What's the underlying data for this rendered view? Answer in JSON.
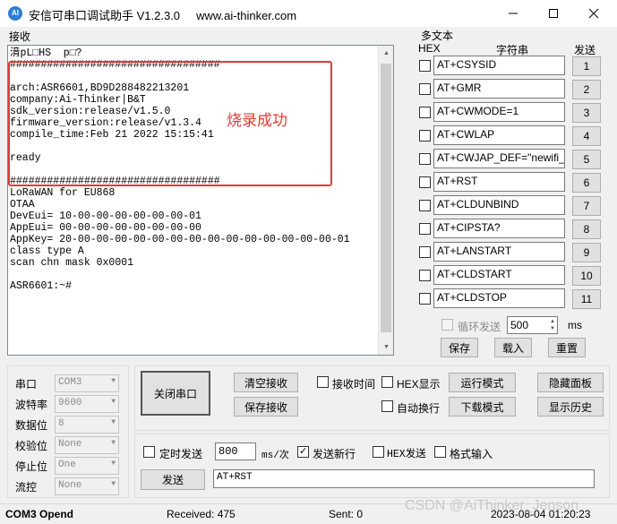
{
  "window": {
    "title": "安信可串口调试助手 V1.2.3.0",
    "url": "www.ai-thinker.com",
    "icon_text": "AI"
  },
  "receive": {
    "label": "接收",
    "text": "湇pL□HS  p□?\n##################################\n\narch:ASR6601,BD9D288482213201\ncompany:Ai-Thinker|B&T\nsdk_version:release/v1.5.0\nfirmware_version:release/v1.3.4\ncompile_time:Feb 21 2022 15:15:41\n\nready\n\n##################################\nLoRaWAN for EU868\nOTAA\nDevEui= 10-00-00-00-00-00-00-01\nAppEui= 00-00-00-00-00-00-00-00\nAppKey= 20-00-00-00-00-00-00-00-00-00-00-00-00-00-00-01\nclass type A\nscan chn mask 0x0001\n\nASR6601:~#",
    "annotation": "烧录成功"
  },
  "multi": {
    "title": "多文本",
    "header_hex": "HEX",
    "header_str": "字符串",
    "header_send": "发送",
    "rows": [
      {
        "cmd": "AT+CSYSID",
        "num": "1"
      },
      {
        "cmd": "AT+GMR",
        "num": "2"
      },
      {
        "cmd": "AT+CWMODE=1",
        "num": "3"
      },
      {
        "cmd": "AT+CWLAP",
        "num": "4"
      },
      {
        "cmd": "AT+CWJAP_DEF=\"newifi_",
        "num": "5"
      },
      {
        "cmd": "AT+RST",
        "num": "6"
      },
      {
        "cmd": "AT+CLDUNBIND",
        "num": "7"
      },
      {
        "cmd": "AT+CIPSTA?",
        "num": "8"
      },
      {
        "cmd": "AT+LANSTART",
        "num": "9"
      },
      {
        "cmd": "AT+CLDSTART",
        "num": "10"
      },
      {
        "cmd": "AT+CLDSTOP",
        "num": "11"
      }
    ],
    "loop_label": "循环发送",
    "loop_value": "500",
    "loop_unit": "ms",
    "save": "保存",
    "load": "载入",
    "reset": "重置"
  },
  "serial": {
    "port_label": "串口",
    "port_value": "COM3",
    "baud_label": "波特率",
    "baud_value": "9600",
    "data_label": "数据位",
    "data_value": "8",
    "check_label": "校验位",
    "check_value": "None",
    "stop_label": "停止位",
    "stop_value": "One",
    "flow_label": "流控",
    "flow_value": "None"
  },
  "controls": {
    "close_port": "关闭串口",
    "clear_recv": "清空接收",
    "save_recv": "保存接收",
    "recv_time": "接收时间",
    "hex_show": "HEX显示",
    "auto_wrap": "自动换行",
    "run_mode": "运行模式",
    "download_mode": "下载模式",
    "hide_panel": "隐藏面板",
    "show_history": "显示历史"
  },
  "send": {
    "timed_label": "定时发送",
    "interval": "800",
    "interval_unit": "ms/次",
    "newline_label": "发送新行",
    "hex_send_label": "HEX发送",
    "format_label": "格式输入",
    "send_button": "发送",
    "send_text": "AT+RST"
  },
  "status": {
    "port_state": "COM3 Opend",
    "received": "Received: 475",
    "sent": "Sent: 0",
    "datetime": "2023-08-04 01:20:23"
  },
  "watermark": "CSDN @AiThinker_Jenson"
}
